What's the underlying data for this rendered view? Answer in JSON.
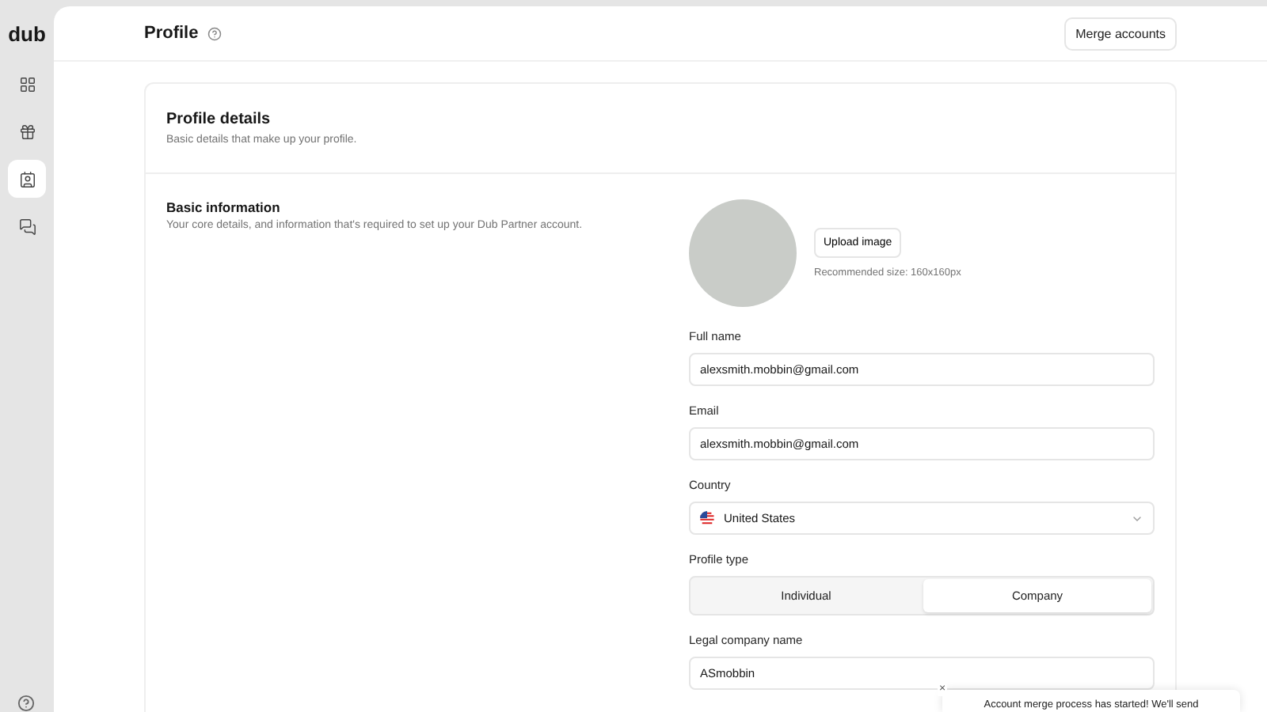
{
  "sidebar": {
    "logo": "dub",
    "items": [
      {
        "kind": "grid",
        "selected": false
      },
      {
        "kind": "gift",
        "selected": false
      },
      {
        "kind": "profile",
        "selected": true
      },
      {
        "kind": "chat",
        "selected": false
      }
    ]
  },
  "header": {
    "title": "Profile",
    "action": "Merge accounts"
  },
  "card": {
    "title": "Profile details",
    "subtitle": "Basic details that make up your profile."
  },
  "section": {
    "title": "Basic information",
    "description": "Your core details, and information that's required to set up your Dub Partner account."
  },
  "avatar": {
    "button": "Upload image",
    "hint": "Recommended size: 160x160px"
  },
  "fields": [
    {
      "kind": "text",
      "label": "Full name",
      "value": "alexsmith.mobbin@gmail.com"
    },
    {
      "kind": "text",
      "label": "Email",
      "value": "alexsmith.mobbin@gmail.com"
    },
    {
      "kind": "select",
      "label": "Country",
      "value": "United States"
    },
    {
      "kind": "segmented",
      "label": "Profile type",
      "options": [
        {
          "label": "Individual",
          "selected": false
        },
        {
          "label": "Company",
          "selected": true
        }
      ]
    },
    {
      "kind": "text",
      "label": "Legal company name",
      "value": "ASmobbin"
    }
  ],
  "toast": {
    "close": "×",
    "message": "Account merge process has started! We'll send"
  }
}
